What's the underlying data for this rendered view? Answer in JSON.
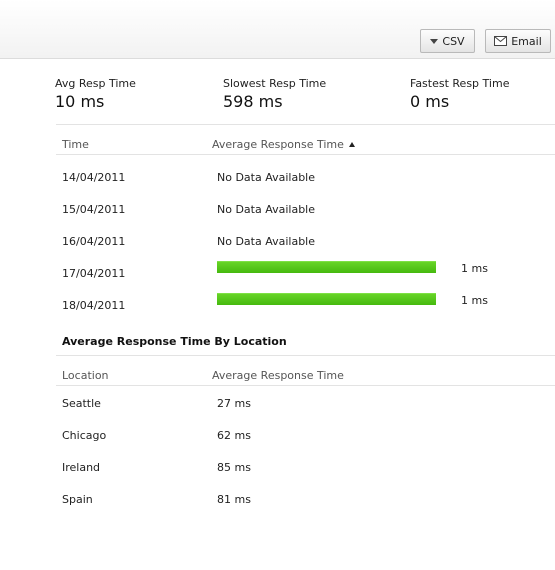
{
  "toolbar": {
    "csv_label": "CSV",
    "email_label": "Email",
    "csv_icon": "dropdown-arrow-icon",
    "email_icon": "envelope-icon"
  },
  "summary": {
    "avg": {
      "label": "Avg Resp Time",
      "value": "10 ms"
    },
    "slowest": {
      "label": "Slowest Resp Time",
      "value": "598 ms"
    },
    "fastest": {
      "label": "Fastest Resp Time",
      "value": "0 ms"
    }
  },
  "daily_table": {
    "headers": {
      "time": "Time",
      "avg": "Average Response Time"
    },
    "sort": "ascending",
    "bar_color": "#52c41a",
    "rows": [
      {
        "date": "14/04/2011",
        "text": "No Data Available",
        "value": "",
        "fraction": 0
      },
      {
        "date": "15/04/2011",
        "text": "No Data Available",
        "value": "",
        "fraction": 0
      },
      {
        "date": "16/04/2011",
        "text": "No Data Available",
        "value": "",
        "fraction": 0
      },
      {
        "date": "17/04/2011",
        "text": "",
        "value": "1 ms",
        "fraction": 1
      },
      {
        "date": "18/04/2011",
        "text": "",
        "value": "1 ms",
        "fraction": 1
      }
    ]
  },
  "location_section": {
    "title": "Average Response Time By Location",
    "headers": {
      "location": "Location",
      "avg": "Average Response Time"
    },
    "rows": [
      {
        "location": "Seattle",
        "value": "27 ms"
      },
      {
        "location": "Chicago",
        "value": "62 ms"
      },
      {
        "location": "Ireland",
        "value": "85 ms"
      },
      {
        "location": "Spain",
        "value": "81 ms"
      }
    ]
  }
}
